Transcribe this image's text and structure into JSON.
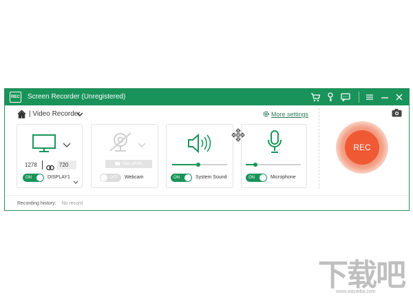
{
  "window": {
    "title": "Screen Recorder (Unregistered)",
    "logo_text": "REC",
    "titlebar_icons": [
      "cart-icon",
      "key-icon",
      "feedback-icon",
      "menu-icon",
      "minimize-icon",
      "close-icon"
    ]
  },
  "nav": {
    "separator": "|",
    "mode": "Video Recorder",
    "more_settings": "More settings"
  },
  "display": {
    "width": "1278",
    "height": "720",
    "toggle": "ON",
    "label": "DISPLAY1"
  },
  "webcam": {
    "button": "Take photo",
    "toggle": "OFF",
    "label": "Webcam"
  },
  "system_sound": {
    "toggle": "ON",
    "label": "System Sound",
    "volume": 0.48
  },
  "microphone": {
    "toggle": "ON",
    "label": "Microphone",
    "volume": 0.18
  },
  "rec_button": "REC",
  "history": {
    "label": "Recording history:",
    "value": "No record"
  },
  "watermark": {
    "text": "下载吧",
    "url": "www.xiazaiba.com"
  },
  "colors": {
    "brand": "#19935a",
    "rec": "#ef5a35"
  }
}
